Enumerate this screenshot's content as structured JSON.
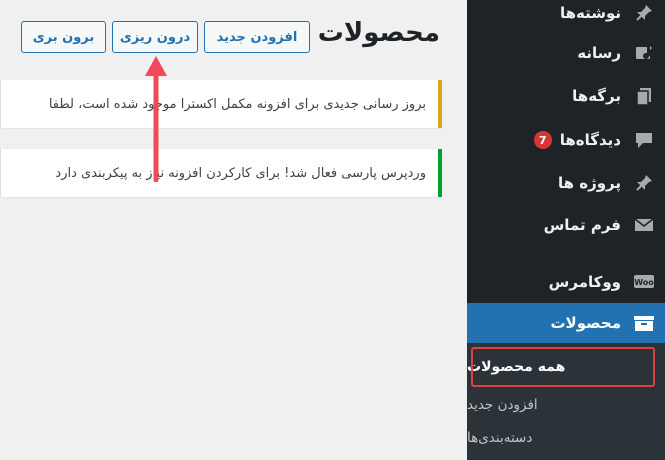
{
  "main": {
    "title": "محصولات",
    "buttons": {
      "add_new": "افزودن جدید",
      "import": "درون ریزی",
      "export": "برون بری"
    },
    "notices": [
      {
        "text": "بروز رسانی جدیدی برای افزونه مکمل اکسترا موجود شده است، لطفا",
        "type": "warning",
        "color": "#dba617"
      },
      {
        "text": "وردپرس پارسی فعال شد! برای کارکردن افزونه نیاز به پیکربندی دارد",
        "type": "success",
        "color": "#00a32a"
      }
    ]
  },
  "sidebar": {
    "items": [
      {
        "label": "نوشته‌ها",
        "icon": "pin-icon"
      },
      {
        "label": "رسانه",
        "icon": "media-icon"
      },
      {
        "label": "برگه‌ها",
        "icon": "pages-icon"
      },
      {
        "label": "دیدگاه‌ها",
        "icon": "comments-icon",
        "badge": "7"
      },
      {
        "label": "پروژه ها",
        "icon": "pin-icon"
      },
      {
        "label": "فرم تماس",
        "icon": "mail-icon"
      },
      {
        "label": "ووکامرس",
        "icon": "woo-icon"
      },
      {
        "label": "محصولات",
        "icon": "archive-icon",
        "active": true
      }
    ],
    "submenu": [
      {
        "label": "همه محصولات",
        "current": true
      },
      {
        "label": "افزودن جدید"
      },
      {
        "label": "دسته‌بندی‌ها"
      }
    ]
  },
  "colors": {
    "sidebar_bg": "#1d2327",
    "active_bg": "#2271b1",
    "submenu_bg": "#2c3338",
    "highlight": "#e04040",
    "arrow": "#f04a5a",
    "badge": "#d63638"
  }
}
